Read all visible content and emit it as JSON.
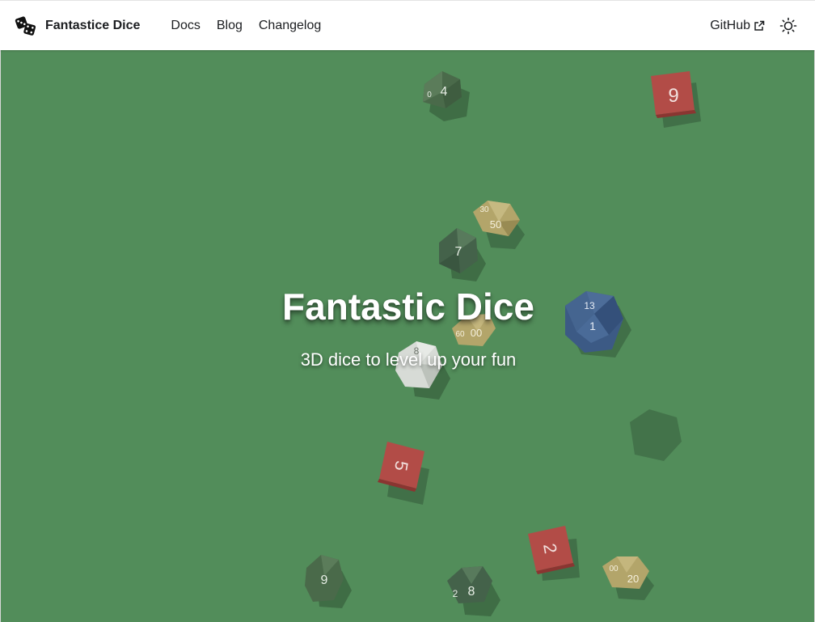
{
  "navbar": {
    "brand_title": "Fantastice Dice",
    "links": [
      {
        "label": "Docs"
      },
      {
        "label": "Blog"
      },
      {
        "label": "Changelog"
      }
    ],
    "github_label": "GitHub"
  },
  "hero": {
    "title": "Fantastic Dice",
    "subtitle": "3D dice to level up your fun",
    "background_color": "#528d5a"
  },
  "dice": {
    "d10_top": {
      "face": "4",
      "extra": "0"
    },
    "d6_red_top": {
      "face": "9"
    },
    "d10_gold_mid": {
      "face": "50",
      "extra": "30"
    },
    "d8_mid": {
      "face": "7"
    },
    "d20_blue": {
      "face": "1",
      "extra": "13"
    },
    "d10_gold_center": {
      "face": "00",
      "extra": "60"
    },
    "d10_white": {
      "face": "8"
    },
    "d6_red_mid": {
      "face": "5"
    },
    "d6_red_bottom": {
      "face": "2"
    },
    "d10_bottom_left": {
      "face": "9"
    },
    "d10_bottom_mid": {
      "face": "8",
      "extra": "2"
    },
    "d10_gold_bottom": {
      "face": "20",
      "extra": "00"
    }
  },
  "colors": {
    "die_green": "#4a6a4a",
    "die_red": "#b24c47",
    "die_gold": "#b3a56a",
    "die_blue": "#3c5a85",
    "die_white": "#d7dbd6"
  }
}
